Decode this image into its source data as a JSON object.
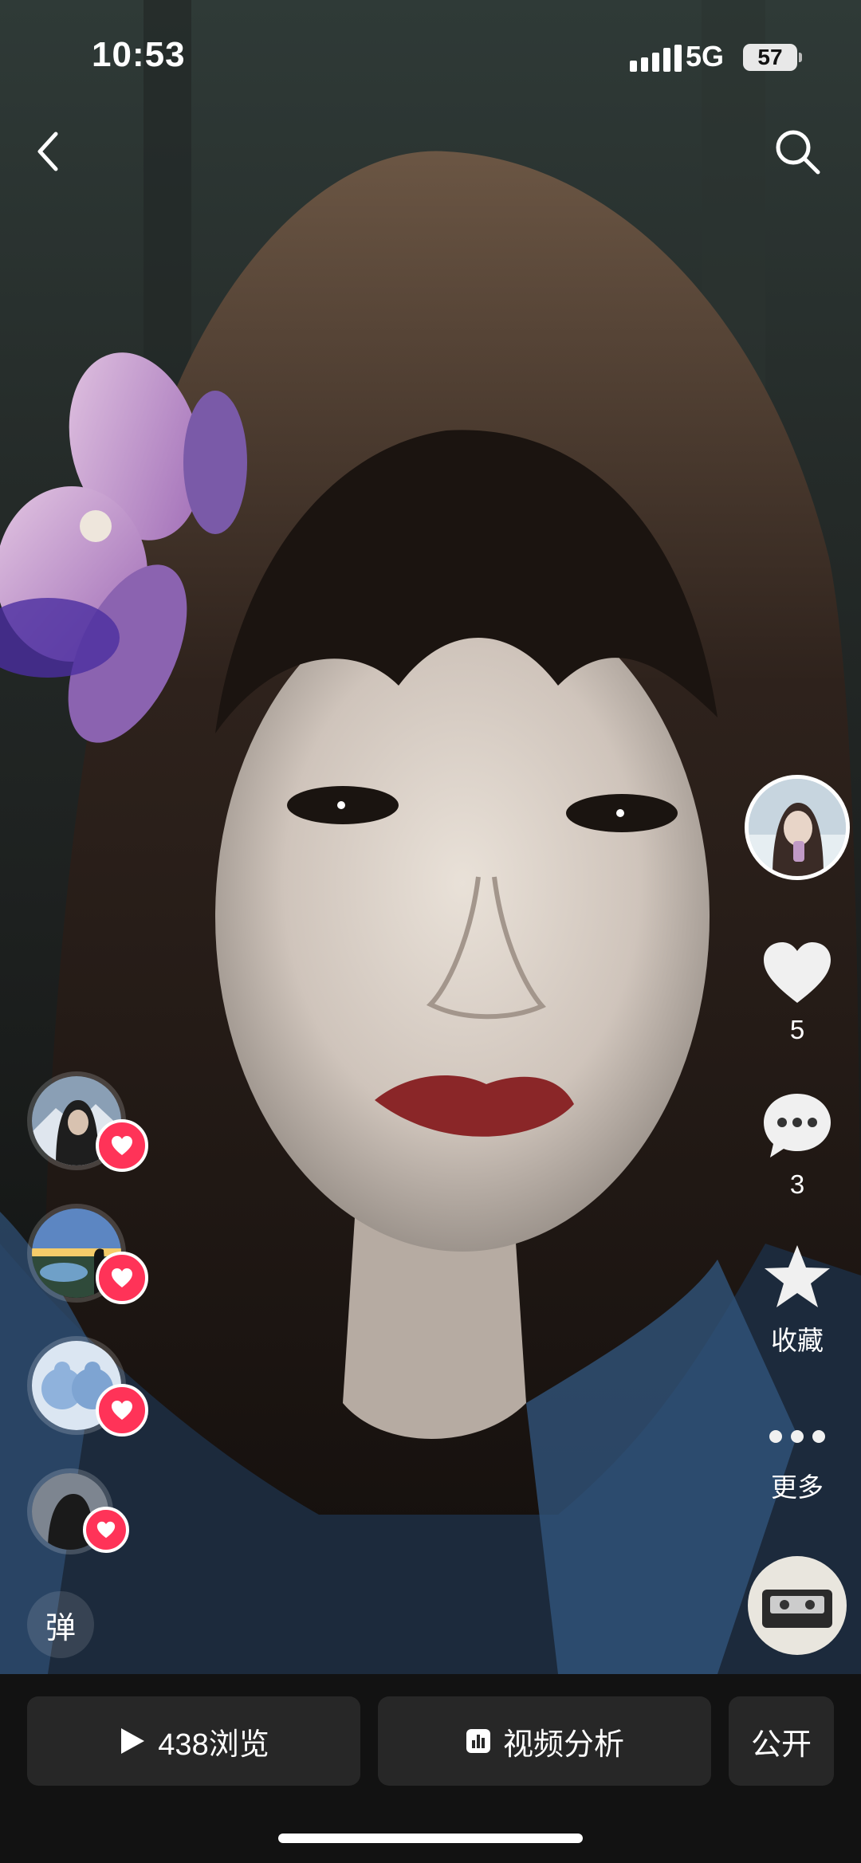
{
  "status_bar": {
    "time": "10:53",
    "network": "5G",
    "battery": "57"
  },
  "video": {
    "actions": {
      "like_count": "5",
      "comment_count": "3",
      "favorite_label": "收藏",
      "more_label": "更多"
    },
    "danmu_label": "弹"
  },
  "bottom_bar": {
    "views_label": "438浏览",
    "analytics_label": "视频分析",
    "visibility_label": "公开"
  },
  "colors": {
    "accent": "#ff3358",
    "bar_bg": "#121212",
    "pill_bg": "#272727"
  }
}
